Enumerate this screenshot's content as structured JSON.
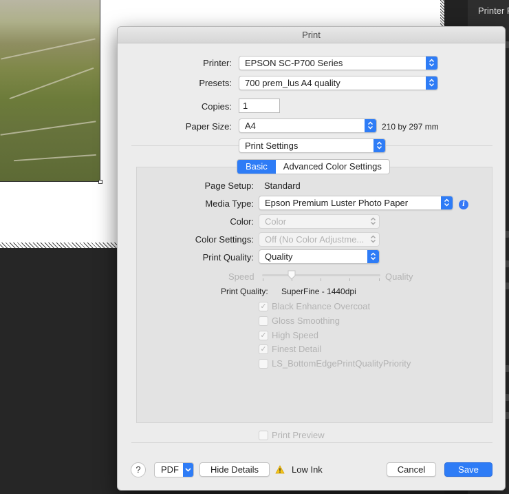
{
  "window": {
    "title": "Print"
  },
  "background": {
    "panel_label": "Printer P"
  },
  "printer": {
    "label": "Printer:",
    "value": "EPSON SC-P700 Series"
  },
  "presets": {
    "label": "Presets:",
    "value": "700 prem_lus A4 quality"
  },
  "copies": {
    "label": "Copies:",
    "value": "1"
  },
  "paper_size": {
    "label": "Paper Size:",
    "value": "A4",
    "dimensions": "210 by 297 mm"
  },
  "section": {
    "value": "Print Settings"
  },
  "tabs": [
    {
      "label": "Basic",
      "selected": true
    },
    {
      "label": "Advanced Color Settings",
      "selected": false
    }
  ],
  "settings": {
    "page_setup": {
      "label": "Page Setup:",
      "value": "Standard"
    },
    "media_type": {
      "label": "Media Type:",
      "value": "Epson Premium Luster Photo Paper"
    },
    "color": {
      "label": "Color:",
      "value": "Color"
    },
    "color_settings": {
      "label": "Color Settings:",
      "value": "Off (No Color Adjustme..."
    },
    "print_quality": {
      "label": "Print Quality:",
      "value": "Quality"
    },
    "slider": {
      "min_label": "Speed",
      "max_label": "Quality"
    },
    "print_quality_info": {
      "label": "Print Quality:",
      "value": "SuperFine - 1440dpi"
    }
  },
  "options": [
    {
      "label": "Black Enhance Overcoat",
      "checked": true
    },
    {
      "label": "Gloss Smoothing",
      "checked": false
    },
    {
      "label": "High Speed",
      "checked": true
    },
    {
      "label": "Finest Detail",
      "checked": true
    },
    {
      "label": "LS_BottomEdgePrintQualityPriority",
      "checked": false
    }
  ],
  "print_preview": {
    "label": "Print Preview",
    "checked": false
  },
  "footer": {
    "help": "?",
    "pdf": "PDF",
    "hide_details": "Hide Details",
    "low_ink": "Low Ink",
    "cancel": "Cancel",
    "save": "Save"
  },
  "colors": {
    "accent": "#2e7cf6",
    "warning": "#f5c518"
  }
}
